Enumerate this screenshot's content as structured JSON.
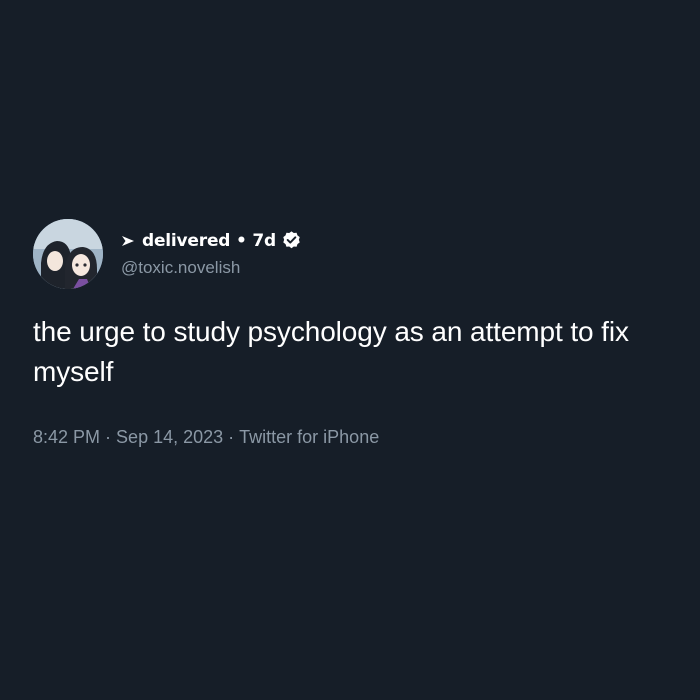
{
  "colors": {
    "background": "#161e28",
    "text_primary": "#ffffff",
    "text_secondary": "#8b98a5",
    "verified_badge": "#ffffff"
  },
  "tweet": {
    "display_name": "delivered • 7d",
    "handle": "@toxic.novelish",
    "text": "the urge to study psychology as an attempt to fix myself",
    "time": "8:42 PM",
    "date": "Sep 14, 2023",
    "source": "Twitter for iPhone",
    "separator": "·",
    "avatar_icon": "anime-couple-avatar",
    "prefix_icon": "arrow-right-icon",
    "badge_icon": "verified-icon"
  }
}
